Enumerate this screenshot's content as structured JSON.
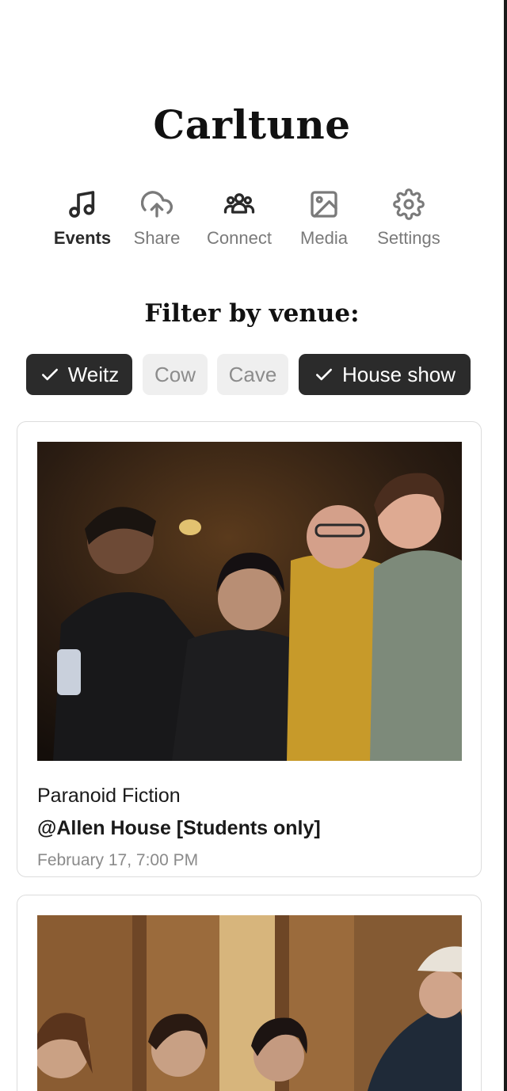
{
  "app": {
    "title": "Carltune"
  },
  "nav": {
    "items": [
      {
        "label": "Events",
        "icon": "music-note-icon",
        "active": true
      },
      {
        "label": "Share",
        "icon": "cloud-upload-icon",
        "active": false
      },
      {
        "label": "Connect",
        "icon": "people-group-icon",
        "active": false
      },
      {
        "label": "Media",
        "icon": "image-icon",
        "active": false
      },
      {
        "label": "Settings",
        "icon": "gear-icon",
        "active": false
      }
    ]
  },
  "filter": {
    "heading": "Filter by venue:",
    "chips": [
      {
        "label": "Weitz",
        "selected": true
      },
      {
        "label": "Cow",
        "selected": false
      },
      {
        "label": "Cave",
        "selected": false
      },
      {
        "label": "House show",
        "selected": true
      }
    ]
  },
  "events": [
    {
      "name": "Paranoid Fiction",
      "venue": "@Allen House [Students only]",
      "date": "February 17, 7:00 PM"
    }
  ],
  "colors": {
    "chip_selected_bg": "#2b2b2b",
    "chip_unselected_bg": "#efefef",
    "text_muted": "#8a8a8a"
  }
}
